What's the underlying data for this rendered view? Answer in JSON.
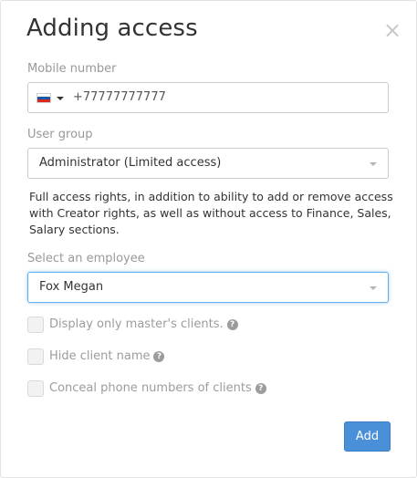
{
  "dialog": {
    "title": "Adding access",
    "close_icon": "close-icon"
  },
  "mobile": {
    "label": "Mobile number",
    "country_flag": "russia-flag-icon",
    "value": "+77777777777"
  },
  "user_group": {
    "label": "User group",
    "selected": "Administrator (Limited access)",
    "description": "Full access rights, in addition to ability to add or remove access with Creator rights, as well as without access to Finance, Sales, Salary sections."
  },
  "employee": {
    "label": "Select an employee",
    "selected": "Fox Megan"
  },
  "options": [
    {
      "label": "Display only master's clients.",
      "checked": false,
      "help": true
    },
    {
      "label": "Hide client name",
      "checked": false,
      "help": true
    },
    {
      "label": "Conceal phone numbers of clients",
      "checked": false,
      "help": true
    }
  ],
  "actions": {
    "add_label": "Add"
  },
  "colors": {
    "primary": "#4a90d9",
    "label": "#999999",
    "focus_border": "#66afe9"
  }
}
